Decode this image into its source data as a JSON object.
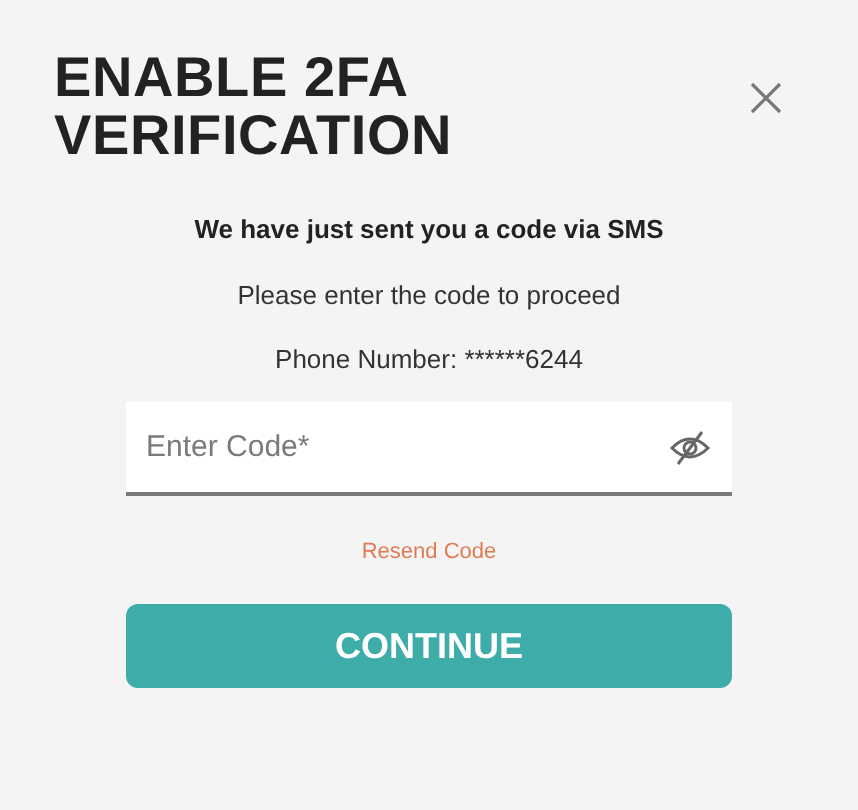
{
  "dialog": {
    "title": "ENABLE 2FA VERIFICATION",
    "heading": "We have just sent you a code via SMS",
    "instruction": "Please enter the code to proceed",
    "phone": "Phone Number: ******6244",
    "code_field": {
      "placeholder": "Enter Code*"
    },
    "resend_link": "Resend Code",
    "button": "CONTINUE"
  }
}
